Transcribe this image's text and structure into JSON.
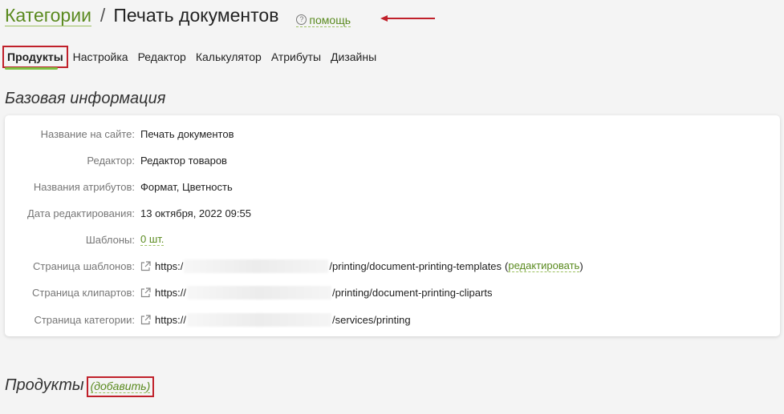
{
  "header": {
    "crumb": "Категории",
    "separator": "/",
    "title": "Печать документов",
    "help_icon": "?",
    "help_label": "помощь"
  },
  "tabs": [
    {
      "label": "Продукты",
      "active": true
    },
    {
      "label": "Настройка"
    },
    {
      "label": "Редактор"
    },
    {
      "label": "Калькулятор"
    },
    {
      "label": "Атрибуты"
    },
    {
      "label": "Дизайны"
    }
  ],
  "base_section": {
    "title": "Базовая информация",
    "rows": [
      {
        "label": "Название на сайте:",
        "value": "Печать документов"
      },
      {
        "label": "Редактор:",
        "value": "Редактор товаров"
      },
      {
        "label": "Названия атрибутов:",
        "value": "Формат, Цветность"
      },
      {
        "label": "Дата редактирования:",
        "value": "13 октября, 2022 09:55"
      },
      {
        "label": "Шаблоны:",
        "value": "0 шт."
      },
      {
        "label": "Страница шаблонов:",
        "prefix": "https:/",
        "suffix": "/printing/document-printing-templates",
        "edit_open": "(",
        "edit_label": "редактировать",
        "edit_close": ")"
      },
      {
        "label": "Страница клипартов:",
        "prefix": "https://",
        "suffix": "/printing/document-printing-cliparts"
      },
      {
        "label": "Страница категории:",
        "prefix": "https://",
        "suffix": "/services/printing"
      }
    ]
  },
  "products_section": {
    "title": "Продукты",
    "add_label": "(добавить)"
  },
  "colors": {
    "accent": "#5a8a1f",
    "highlight": "#c0202a",
    "tab_underline": "#7cc242"
  }
}
